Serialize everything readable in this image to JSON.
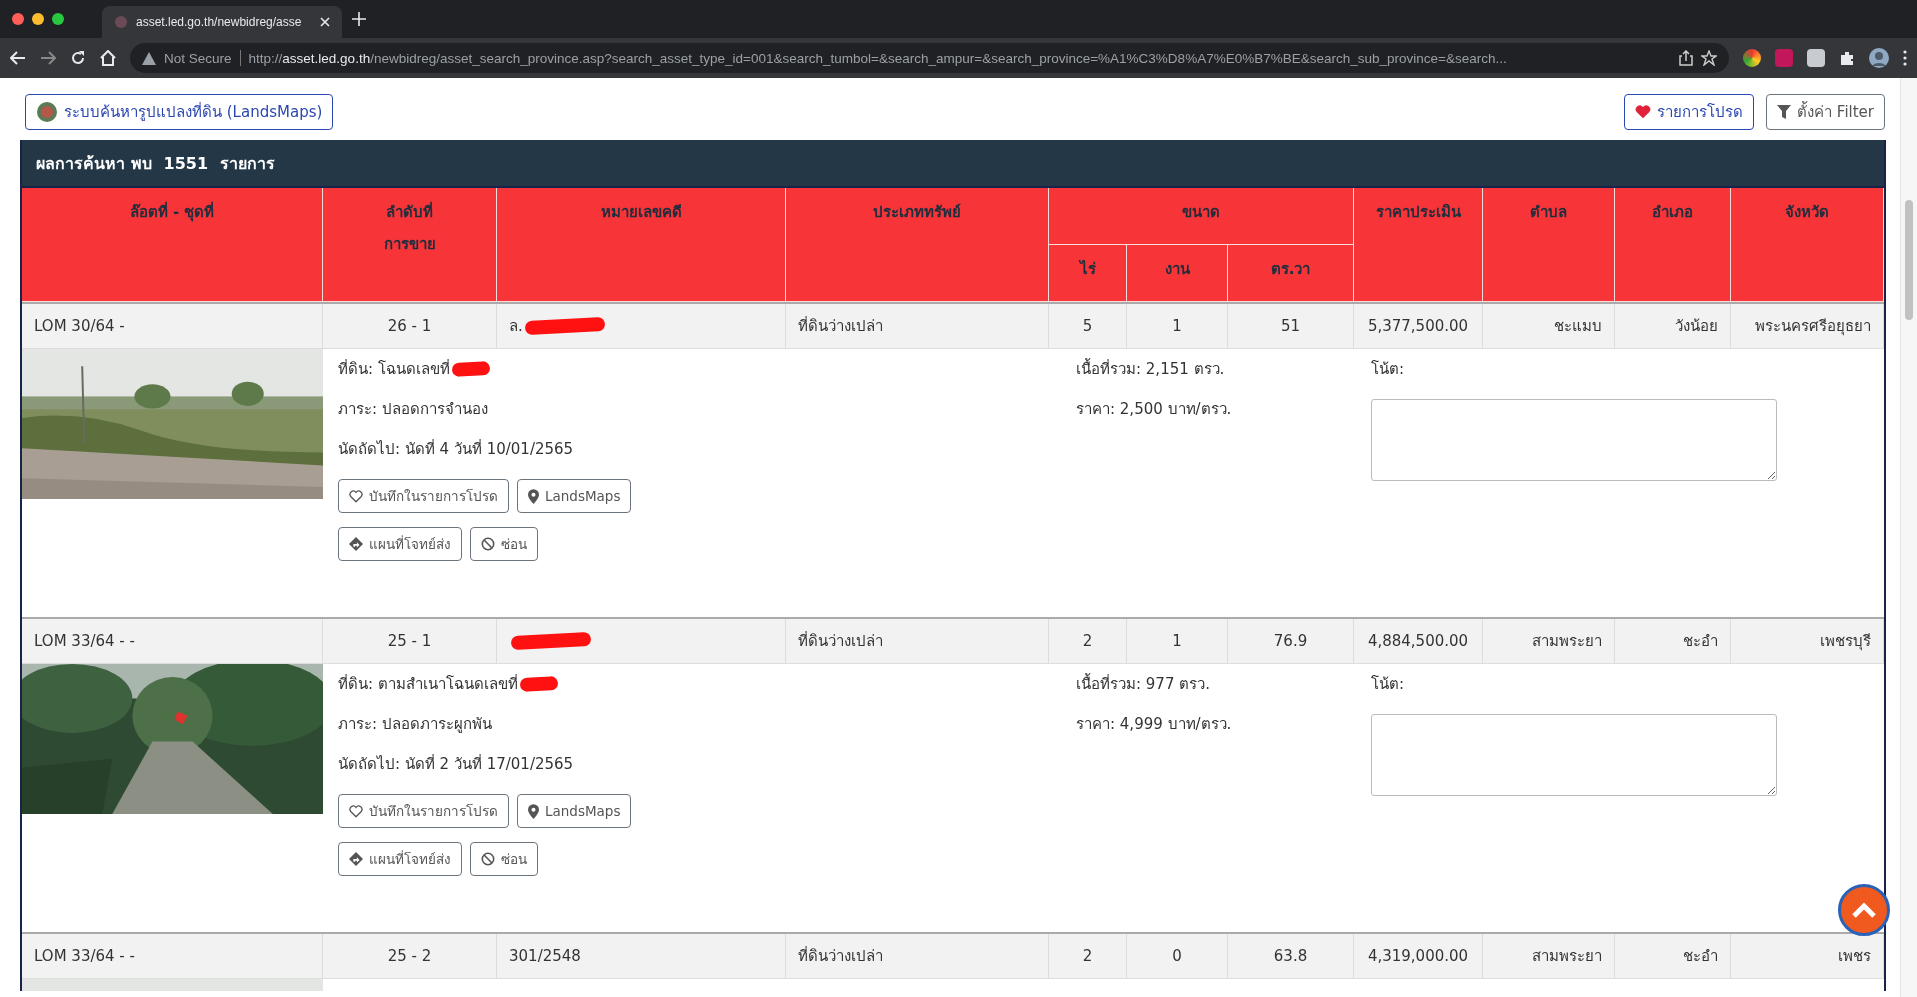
{
  "browser": {
    "tab_title": "asset.led.go.th/newbidreg/asse",
    "security": "Not Secure",
    "url_scheme": "http://",
    "url_host": "asset.led.go.th",
    "url_path": "/newbidreg/asset_search_province.asp?search_asset_type_id=001&search_tumbol=&search_ampur=&search_province=%A1%C3%D8%A7%E0%B7%BE&search_sub_province=&search..."
  },
  "toolbar": {
    "landsmaps_link": "ระบบค้นหารูปแปลงที่ดิน (LandsMaps)",
    "favorites_button": "รายการโปรด",
    "filter_button": "ตั้งค่า Filter"
  },
  "results": {
    "title": "ผลการค้นหา พบ",
    "count": "1551",
    "unit": "รายการ"
  },
  "table": {
    "group_header": {
      "label": "ขนาด"
    },
    "columns": [
      {
        "label": "ล๊อตที่ - ชุดที่"
      },
      {
        "label": "ลำดับที่\nการขาย"
      },
      {
        "label": "หมายเลขคดี"
      },
      {
        "label": "ประเภททรัพย์"
      },
      {
        "label": "ไร่",
        "in_group": true
      },
      {
        "label": "งาน",
        "in_group": true
      },
      {
        "label": "ตร.วา",
        "in_group": true
      },
      {
        "label": "ราคาประเมิน"
      },
      {
        "label": "ตำบล"
      },
      {
        "label": "อำเภอ"
      },
      {
        "label": "จังหวัด"
      }
    ],
    "rows": [
      {
        "cells": [
          {
            "text": "LOM 30/64 -"
          },
          {
            "text": "26 - 1"
          },
          {
            "text": "ล.",
            "redacted": true
          },
          {
            "text": "ที่ดินว่างเปล่า"
          },
          {
            "text": "5"
          },
          {
            "text": "1"
          },
          {
            "text": "51"
          },
          {
            "text": "5,377,500.00"
          },
          {
            "text": "ชะแมบ"
          },
          {
            "text": "วังน้อย"
          },
          {
            "text": "พระนครศรีอยุธยา"
          }
        ],
        "detail": {
          "deed": "ที่ดิน: โฉนดเลขที่",
          "deed_redacted": true,
          "burden": "ภาระ: ปลอดการจำนอง",
          "next_date": "นัดถัดไป: นัดที่ 4 วันที่ 10/01/2565",
          "area": "เนื้อที่รวม: 2,151 ตรว.",
          "price": "ราคา: 2,500 บาท/ตรว.",
          "note_label": "โน้ต:",
          "buttons": [
            {
              "kind": "favorite",
              "label": "บันทึกในรายการโปรด"
            },
            {
              "kind": "map",
              "label": "LandsMaps"
            },
            {
              "kind": "directions",
              "label": "แผนที่โจทย์ส่ง"
            },
            {
              "kind": "hide",
              "label": "ซ่อน"
            }
          ]
        }
      },
      {
        "cells": [
          {
            "text": "LOM 33/64 - -"
          },
          {
            "text": "25 - 1"
          },
          {
            "redacted": true
          },
          {
            "text": "ที่ดินว่างเปล่า"
          },
          {
            "text": "2"
          },
          {
            "text": "1"
          },
          {
            "text": "76.9"
          },
          {
            "text": "4,884,500.00"
          },
          {
            "text": "สามพระยา"
          },
          {
            "text": "ชะอำ"
          },
          {
            "text": "เพชรบุรี"
          }
        ],
        "detail": {
          "deed": "ที่ดิน: ตามสำเนาโฉนดเลขที่",
          "deed_redacted": true,
          "burden": "ภาระ: ปลอดภาระผูกพัน",
          "next_date": "นัดถัดไป: นัดที่ 2 วันที่ 17/01/2565",
          "area": "เนื้อที่รวม: 977 ตรว.",
          "price": "ราคา: 4,999 บาท/ตรว.",
          "note_label": "โน้ต:",
          "buttons": [
            {
              "kind": "favorite",
              "label": "บันทึกในรายการโปรด"
            },
            {
              "kind": "map",
              "label": "LandsMaps"
            },
            {
              "kind": "directions",
              "label": "แผนที่โจทย์ส่ง"
            },
            {
              "kind": "hide",
              "label": "ซ่อน"
            }
          ]
        }
      },
      {
        "cells": [
          {
            "text": "LOM 33/64 - -"
          },
          {
            "text": "25 - 2"
          },
          {
            "text": "301/2548"
          },
          {
            "text": "ที่ดินว่างเปล่า"
          },
          {
            "text": "2"
          },
          {
            "text": "0"
          },
          {
            "text": "63.8"
          },
          {
            "text": "4,319,000.00"
          },
          {
            "text": "สามพระยา"
          },
          {
            "text": "ชะอำ"
          },
          {
            "text": "เพชร"
          }
        ]
      }
    ]
  }
}
